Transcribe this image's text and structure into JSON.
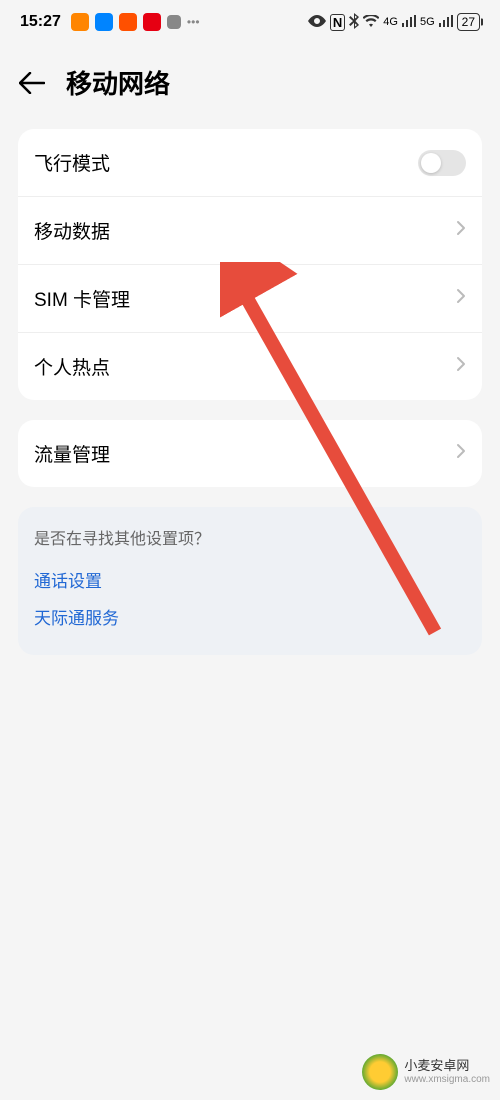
{
  "statusBar": {
    "time": "15:27",
    "battery": "27",
    "signal1": "4G",
    "signal2": "5G"
  },
  "header": {
    "title": "移动网络"
  },
  "card1": {
    "airplane": "飞行模式",
    "mobileData": "移动数据",
    "simManagement": "SIM 卡管理",
    "hotspot": "个人热点"
  },
  "card2": {
    "dataUsage": "流量管理"
  },
  "hint": {
    "title": "是否在寻找其他设置项？",
    "link1": "通话设置",
    "link2": "天际通服务"
  },
  "watermark": {
    "name": "小麦安卓网",
    "url": "www.xmsigma.com"
  }
}
